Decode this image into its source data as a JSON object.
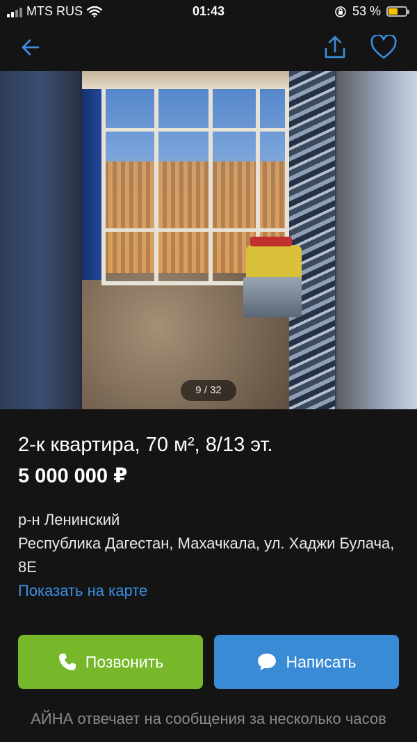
{
  "status_bar": {
    "carrier": "MTS RUS",
    "time": "01:43",
    "battery_percent": "53 %",
    "battery_level": 0.53
  },
  "nav": {
    "back_icon": "arrow-left-icon",
    "share_icon": "share-icon",
    "favorite_icon": "heart-icon",
    "accent_color": "#3b8fe0"
  },
  "gallery": {
    "counter": "9 / 32"
  },
  "listing": {
    "title": "2-к квартира, 70 м², 8/13 эт.",
    "price": "5 000 000 ₽",
    "district": "р-н Ленинский",
    "address": "Республика Дагестан, Махачкала, ул. Хаджи Булача, 8Е",
    "map_link": "Показать на карте"
  },
  "actions": {
    "call_label": "Позвонить",
    "call_color": "#76b82a",
    "write_label": "Написать",
    "write_color": "#3a8bd6"
  },
  "note": {
    "text": "АЙНА отвечает на сообщения за несколько часов"
  }
}
